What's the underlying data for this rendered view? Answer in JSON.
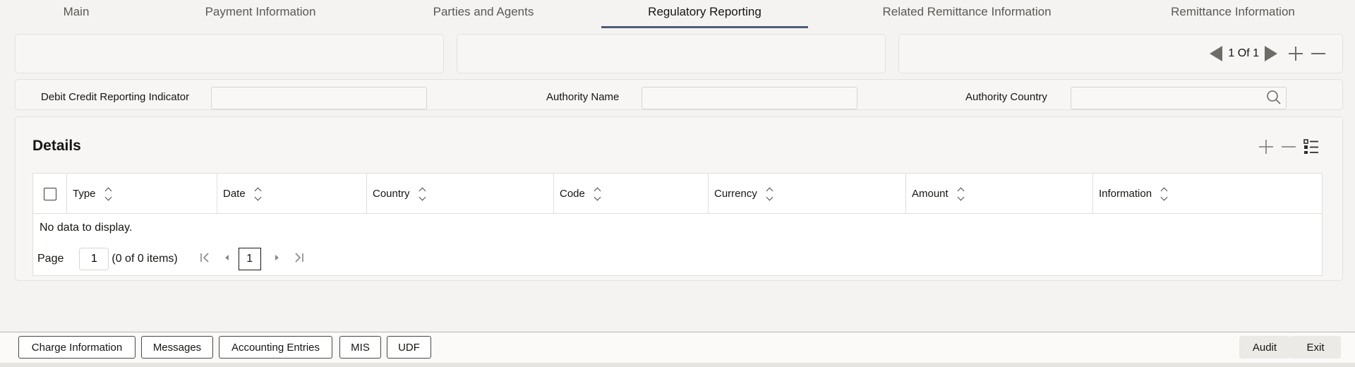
{
  "tabs": [
    {
      "label": "Main"
    },
    {
      "label": "Payment Information"
    },
    {
      "label": "Parties and Agents"
    },
    {
      "label": "Regulatory Reporting"
    },
    {
      "label": "Related Remittance Information"
    },
    {
      "label": "Remittance Information"
    }
  ],
  "active_tab": "Regulatory Reporting",
  "record_nav": {
    "text": "1 Of 1"
  },
  "fields": {
    "debit_credit": {
      "label": "Debit Credit Reporting Indicator",
      "value": ""
    },
    "authority_name": {
      "label": "Authority Name",
      "value": ""
    },
    "authority_country": {
      "label": "Authority Country",
      "value": ""
    }
  },
  "details": {
    "title": "Details",
    "columns": [
      "Type",
      "Date",
      "Country",
      "Code",
      "Currency",
      "Amount",
      "Information"
    ],
    "rows": [],
    "empty_text": "No data to display.",
    "pagination": {
      "page_label": "Page",
      "page_value": "1",
      "items_text": "(0 of 0 items)",
      "current": "1"
    }
  },
  "footer": {
    "left_buttons": [
      "Charge Information",
      "Messages",
      "Accounting Entries",
      "MIS",
      "UDF"
    ],
    "right_buttons": [
      "Audit",
      "Exit"
    ]
  },
  "colors": {
    "accent": "#4d5d74",
    "background": "#f4f3f1",
    "panel": "#f7f6f4"
  }
}
